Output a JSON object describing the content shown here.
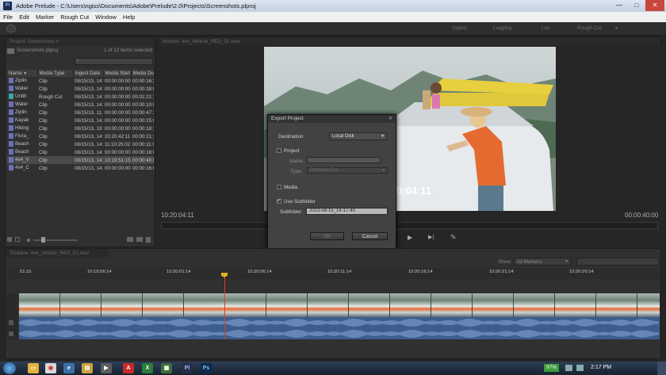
{
  "window": {
    "title": "Adobe Prelude - C:\\Users\\ngiss\\Documents\\Adobe\\Prelude\\2.0\\Projects\\Screenshots.plproj",
    "app_icon": "Pl",
    "minimize": "—",
    "maximize": "□",
    "close": "✕"
  },
  "menu": [
    "File",
    "Edit",
    "Marker",
    "Rough Cut",
    "Window",
    "Help"
  ],
  "header": {
    "tabs": [
      "Ingest",
      "Logging",
      "List",
      "Rough Cut"
    ]
  },
  "project": {
    "tab_label": "Project: Screenshots ≡",
    "file_name": "Screenshots.plproj",
    "items_selected": "1 of 12 items selected",
    "columns": [
      "Name",
      "Media Type",
      "Ingest Date",
      "Media Start",
      "Media Du..."
    ],
    "rows": [
      {
        "name": "Ziplin",
        "type": "Clip",
        "date": "08/15/13, 14:",
        "start": "00:00:00:00",
        "dur": "00:00:16:21",
        "kind": "clip"
      },
      {
        "name": "Water",
        "type": "Clip",
        "date": "08/15/13, 14:",
        "start": "00:00:00:00",
        "dur": "00:00:28:03",
        "kind": "clip"
      },
      {
        "name": "Untitl",
        "type": "Rough Cut",
        "date": "08/15/13, 14:",
        "start": "00:00:00:00",
        "dur": "00:02:21:13",
        "kind": "roughcut"
      },
      {
        "name": "Water",
        "type": "Clip",
        "date": "08/15/13, 14:",
        "start": "00:00:00:00",
        "dur": "00:00:10:09",
        "kind": "clip"
      },
      {
        "name": "Ziplin",
        "type": "Clip",
        "date": "08/15/13, 11:43:26:06",
        "start": "00:00:00:00",
        "dur": "00:00:47:10",
        "kind": "clip"
      },
      {
        "name": "Kayak",
        "type": "Clip",
        "date": "08/15/13, 14:",
        "start": "00:00:00:00",
        "dur": "00:00:25:09",
        "kind": "clip"
      },
      {
        "name": "Hiking",
        "type": "Clip",
        "date": "08/15/13, 19:26:47:17",
        "start": "00:00:00:00",
        "dur": "00:00:18:18",
        "kind": "clip"
      },
      {
        "name": "Flora_",
        "type": "Clip",
        "date": "08/15/13, 14:",
        "start": "20:20:42:11",
        "dur": "00:00:21:16",
        "kind": "clip"
      },
      {
        "name": "Beach",
        "type": "Clip",
        "date": "08/15/13, 14:",
        "start": "11:10:25:02",
        "dur": "00:00:11:02",
        "kind": "clip"
      },
      {
        "name": "Beach",
        "type": "Clip",
        "date": "08/15/13, 14:",
        "start": "00:00:00:00",
        "dur": "00:00:18:08",
        "kind": "clip"
      },
      {
        "name": "4x4_V",
        "type": "Clip",
        "date": "08/15/13, 14:",
        "start": "10:19:51:15",
        "dur": "00:00:40:00",
        "kind": "clip",
        "selected": true
      },
      {
        "name": "4x4_C",
        "type": "Clip",
        "date": "08/15/13, 14:",
        "start": "00:00:00:00",
        "dur": "00:00:16:09",
        "kind": "clip"
      }
    ]
  },
  "monitor": {
    "tab_label": "Monitor: 4x4_Vehicle_RED_01.mov",
    "overlay_timecode": "0:04:11",
    "current_time": "10:20:04:11",
    "duration": "00:00:40:00"
  },
  "dialog": {
    "title": "Export Project",
    "close": "✕",
    "destination_label": "Destination:",
    "destination_value": "Local Disk",
    "project_label": "Project",
    "project_checked": false,
    "name_label": "Name:",
    "type_label": "Type:",
    "type_value": "Premiere Pro",
    "media_label": "Media",
    "media_checked": false,
    "use_subfolder_label": "Use Subfolder",
    "use_subfolder_checked": true,
    "subfolder_label": "Subfolder:",
    "subfolder_value": "2013-08-15_14-17-40",
    "ok_label": "OK",
    "cancel_label": "Cancel"
  },
  "timeline": {
    "tab_label": "Timeline: 4x4_Vehicle_RED_01.mov",
    "show_label": "Show:",
    "show_value": "All Markers",
    "ticks": [
      "51:15",
      "10:19:56:14",
      "10:20:01:14",
      "10:20:06:14",
      "10:20:11:14",
      "10:20:16:14",
      "10:20:21:14",
      "10:20:26:14"
    ]
  },
  "taskbar": {
    "battery": "97%",
    "time": "2:17 PM",
    "apps": [
      "Chrome",
      "IE",
      "Explorer",
      "Media",
      "Acrobat",
      "Excel",
      "Prelude",
      "Photoshop"
    ]
  }
}
